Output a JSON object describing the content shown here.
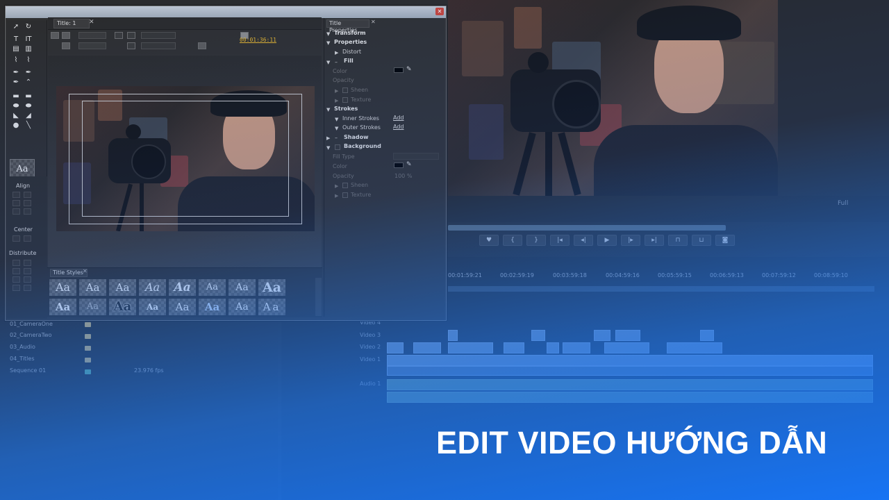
{
  "headline": "EDIT VIDEO HƯỚNG DẪN",
  "title_window": {
    "tab_title": "Title: 1",
    "timecode": "00:01:36:11",
    "title_styles_tab": "Title Styles",
    "style_sample": "Aa",
    "swatch_sample": "Aa"
  },
  "align_panel": {
    "align_label": "Align",
    "center_label": "Center",
    "distribute_label": "Distribute"
  },
  "title_properties": {
    "tab_label": "Title Properties",
    "transform": "Transform",
    "properties": "Properties",
    "distort": "Distort",
    "fill": "Fill",
    "color": "Color",
    "opacity": "Opacity",
    "sheen": "Sheen",
    "texture": "Texture",
    "strokes": "Strokes",
    "inner_strokes": "Inner Strokes",
    "outer_strokes": "Outer Strokes",
    "add": "Add",
    "shadow": "Shadow",
    "background": "Background",
    "fill_type": "Fill Type",
    "bg_color": "Color",
    "bg_opacity": "Opacity",
    "bg_opacity_value": "100 %",
    "bg_sheen": "Sheen",
    "bg_texture": "Texture"
  },
  "program_monitor": {
    "zoom": "Full"
  },
  "timeline": {
    "timecodes": [
      "00:01:59:21",
      "00:02:59:19",
      "00:03:59:18",
      "00:04:59:16",
      "00:05:59:15",
      "00:06:59:13",
      "00:07:59:12",
      "00:08:59:10"
    ],
    "tracks": [
      "Video 4",
      "Video 3",
      "Video 2",
      "Video 1",
      "Audio 1"
    ]
  },
  "project": {
    "items": [
      {
        "name": "01_CameraOne",
        "extra": ""
      },
      {
        "name": "02_CameraTwo",
        "extra": ""
      },
      {
        "name": "03_Audio",
        "extra": ""
      },
      {
        "name": "04_Titles",
        "extra": ""
      },
      {
        "name": "Sequence 01",
        "extra": "23.976 fps"
      }
    ]
  },
  "colors": {
    "overlay_blue": "#1e78ff",
    "timecode_yellow": "#e6b52c",
    "headline_white": "#ffffff"
  }
}
